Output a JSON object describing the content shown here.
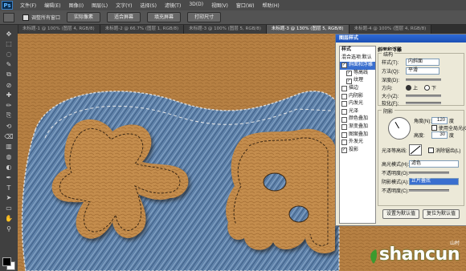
{
  "app": {
    "logo_text": "Ps"
  },
  "menu": [
    "文件(F)",
    "编辑(E)",
    "图像(I)",
    "图层(L)",
    "文字(Y)",
    "选择(S)",
    "滤镜(T)",
    "3D(D)",
    "视图(V)",
    "窗口(W)",
    "帮助(H)"
  ],
  "options_bar": {
    "checkbox_label": "调整所有窗口",
    "buttons": [
      "实际像素",
      "适合屏幕",
      "填充屏幕",
      "打印尺寸"
    ]
  },
  "tabs": [
    {
      "label": "未标题-1 @ 100% (图层 4, RGB/8)",
      "active": false
    },
    {
      "label": "未标题-2 @ 66.7% (图层 1, RGB/8)",
      "active": false
    },
    {
      "label": "未标题-3 @ 100% (图层 5, RGB/8)",
      "active": false
    },
    {
      "label": "未标题-3 @ 130% (图层 5, RGB/8)",
      "active": true
    },
    {
      "label": "未标题-4 @ 100% (图层 4, RGB/8)",
      "active": false
    }
  ],
  "toolbar_icons": [
    "move-icon",
    "marquee-icon",
    "lasso-icon",
    "quick-select-icon",
    "crop-icon",
    "eyedropper-icon",
    "healing-icon",
    "brush-icon",
    "stamp-icon",
    "history-brush-icon",
    "eraser-icon",
    "gradient-icon",
    "blur-icon",
    "dodge-icon",
    "pen-icon",
    "type-icon",
    "path-select-icon",
    "shape-icon",
    "hand-icon",
    "zoom-icon"
  ],
  "layer_style_dialog": {
    "title": "图层样式",
    "styles_header": "样式",
    "blend_default": "混合选项:默认",
    "items": [
      {
        "label": "斜面和浮雕",
        "checked": true,
        "selected": true,
        "sub": false
      },
      {
        "label": "等高线",
        "checked": true,
        "selected": false,
        "sub": true
      },
      {
        "label": "纹理",
        "checked": true,
        "selected": false,
        "sub": true
      },
      {
        "label": "描边",
        "checked": false,
        "selected": false,
        "sub": false
      },
      {
        "label": "内阴影",
        "checked": false,
        "selected": false,
        "sub": false
      },
      {
        "label": "内发光",
        "checked": false,
        "selected": false,
        "sub": false
      },
      {
        "label": "光泽",
        "checked": false,
        "selected": false,
        "sub": false
      },
      {
        "label": "颜色叠加",
        "checked": false,
        "selected": false,
        "sub": false
      },
      {
        "label": "渐变叠加",
        "checked": false,
        "selected": false,
        "sub": false
      },
      {
        "label": "图案叠加",
        "checked": false,
        "selected": false,
        "sub": false
      },
      {
        "label": "外发光",
        "checked": false,
        "selected": false,
        "sub": false
      },
      {
        "label": "投影",
        "checked": true,
        "selected": false,
        "sub": false
      }
    ],
    "bevel": {
      "section_title": "斜面和浮雕",
      "structure_title": "结构",
      "style_label": "样式(T):",
      "style_value": "内斜面",
      "technique_label": "方法(Q):",
      "technique_value": "平滑",
      "depth_label": "深度(D):",
      "direction_label": "方向:",
      "direction_up": "上",
      "direction_down": "下",
      "size_label": "大小(Z):",
      "soften_label": "软化(F):"
    },
    "shading": {
      "title": "阴影",
      "angle_label": "角度(N):",
      "angle_value": "120",
      "angle_unit": "度",
      "global_light_label": "使用全局光(G)",
      "altitude_label": "高度:",
      "altitude_value": "30",
      "altitude_unit": "度",
      "gloss_label": "光泽等高线:",
      "antialias_label": "消除锯齿(L)",
      "highlight_label": "高光模式(H):",
      "highlight_value": "滤色",
      "highlight_opacity_label": "不透明度(O):",
      "shadow_label": "阴影模式(A):",
      "shadow_value": "正片叠底",
      "shadow_opacity_label": "不透明度(C):"
    },
    "buttons": {
      "set_default": "设置为默认值",
      "reset_default": "复位为默认值"
    }
  },
  "watermark": {
    "text": "shancun",
    "sub": "山村"
  },
  "colors": {
    "denim": "#5d7fa6",
    "leather": "#c08a4a",
    "dialog_bg": "#ece9d8",
    "title_blue": "#1b4fb4",
    "watermark_green": "#2a6a22"
  }
}
